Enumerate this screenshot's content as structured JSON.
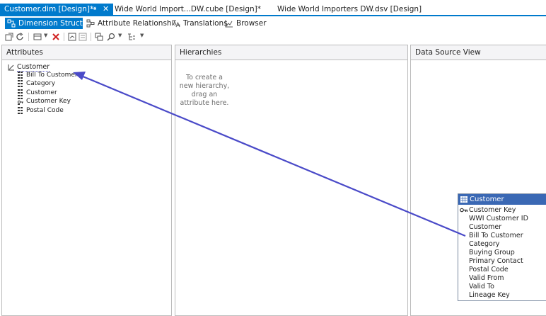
{
  "document_tabs": [
    {
      "label": "Customer.dim [Design]*",
      "pin_icon": "pin-icon",
      "close_icon": "close-icon"
    },
    {
      "label": "Wide World Import...DW.cube [Design]*"
    },
    {
      "label": "Wide World Importers DW.dsv [Design]"
    }
  ],
  "designer_tabs": [
    {
      "label": "Dimension Struct..."
    },
    {
      "label": "Attribute Relationshi..."
    },
    {
      "label": "Translations"
    },
    {
      "label": "Browser"
    }
  ],
  "panes": {
    "attributes": {
      "title": "Attributes",
      "root": "Customer",
      "items": [
        "Bill To Customer",
        "Category",
        "Customer",
        "Customer Key",
        "Postal Code"
      ]
    },
    "hierarchies": {
      "title": "Hierarchies",
      "hint_lines": [
        "To create a",
        "new hierarchy,",
        "drag an",
        "attribute here."
      ]
    },
    "dsv": {
      "title": "Data Source View"
    }
  },
  "dsv_table": {
    "name": "Customer",
    "columns": [
      "Customer Key",
      "WWI Customer ID",
      "Customer",
      "Bill To Customer",
      "Category",
      "Buying Group",
      "Primary Contact",
      "Postal Code",
      "Valid From",
      "Valid To",
      "Lineage Key"
    ]
  },
  "colors": {
    "accent": "#007acc",
    "table_header": "#3a68b4",
    "drag_arrow": "#4a4ac8"
  }
}
